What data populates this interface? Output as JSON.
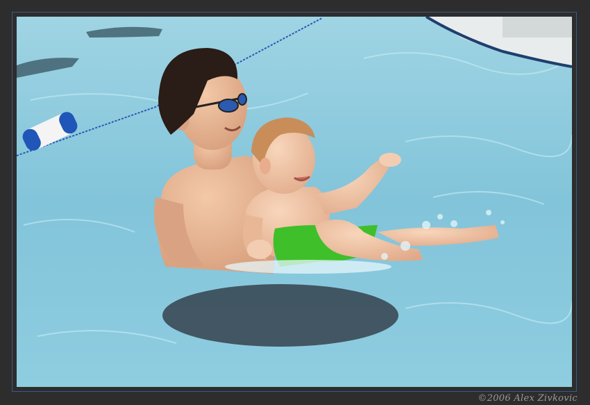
{
  "photo": {
    "credit": "©2006 Alex Zivkovic"
  },
  "colors": {
    "frame": "#2d2d2d",
    "border": "#3a5a8a",
    "water": "#7ec3d8",
    "water_deep": "#5aa9c4",
    "skin": "#e8b896",
    "hair": "#2a1c16",
    "baby_hair": "#c98d5a",
    "swim_diaper": "#3fbf2a",
    "float_blue": "#1f56b8",
    "credit": "#9a9a9a"
  }
}
